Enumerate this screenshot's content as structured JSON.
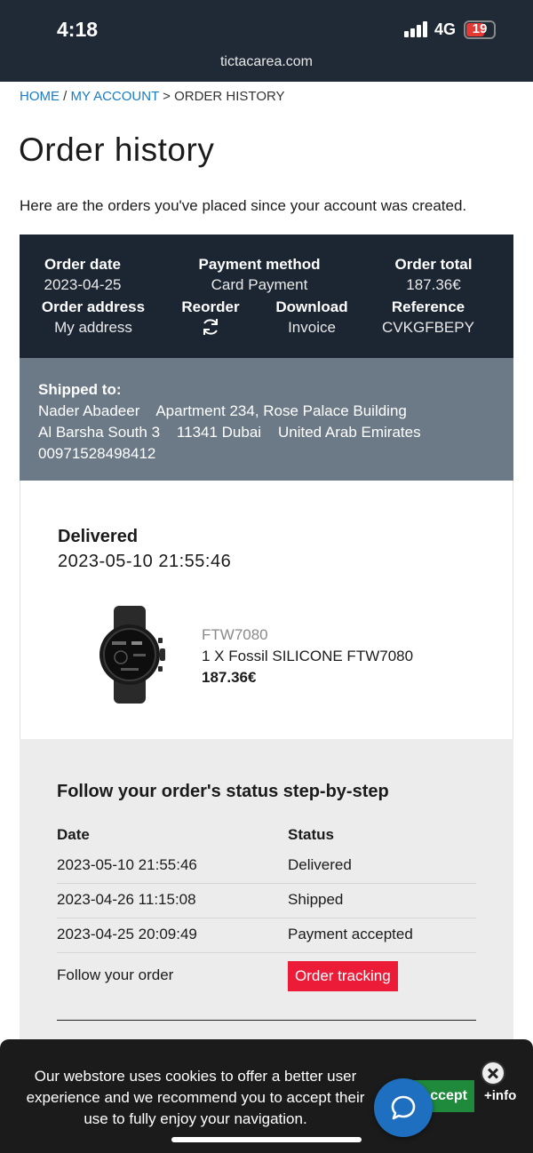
{
  "statusbar": {
    "time": "4:18",
    "network": "4G",
    "battery": "19",
    "url": "tictacarea.com"
  },
  "breadcrumb": {
    "home": "HOME",
    "sep1": " / ",
    "account": "MY ACCOUNT",
    "sep2": " > ",
    "current": "ORDER HISTORY"
  },
  "page": {
    "title": "Order history",
    "intro": "Here are the orders you've placed since your account was created."
  },
  "order": {
    "date_label": "Order date",
    "date": "2023-04-25",
    "payment_label": "Payment method",
    "payment": "Card Payment",
    "total_label": "Order total",
    "total": "187.36€",
    "address_label": "Order address",
    "address": "My address",
    "reorder_label": "Reorder",
    "download_label": "Download",
    "download": "Invoice",
    "reference_label": "Reference",
    "reference": "CVKGFBEPY"
  },
  "shipping": {
    "label": "Shipped to:",
    "line1": "Nader Abadeer    Apartment 234, Rose Palace Building",
    "line2": "Al Barsha South 3    11341 Dubai    United Arab Emirates",
    "line3": "00971528498412"
  },
  "delivery": {
    "state": "Delivered",
    "date": "2023-05-10 21:55:46",
    "product": {
      "ref": "FTW7080",
      "name": "1 X  Fossil SILICONE FTW7080",
      "price": "187.36€"
    }
  },
  "tracking": {
    "title": "Follow your order's status step-by-step",
    "col_date": "Date",
    "col_status": "Status",
    "rows": [
      {
        "date": "2023-05-10 21:55:46",
        "status": "Delivered"
      },
      {
        "date": "2023-04-26 11:15:08",
        "status": "Shipped"
      },
      {
        "date": "2023-04-25 20:09:49",
        "status": "Payment accepted"
      }
    ],
    "follow_label": "Follow your order",
    "button": "Order tracking"
  },
  "cookie": {
    "line1": "Our webstore uses cookies to offer a better user",
    "line2": "experience and we recommend you to accept their",
    "line3": "use to fully enjoy your navigation.",
    "accept": "Accept",
    "info": "+info"
  }
}
